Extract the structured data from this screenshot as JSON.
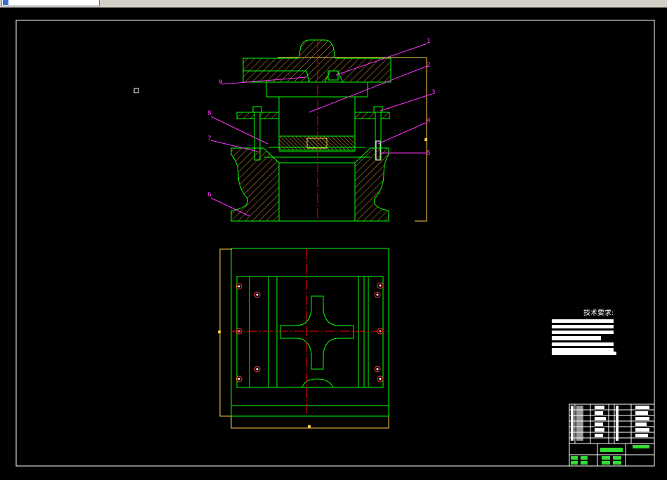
{
  "app": {
    "tab_title": ""
  },
  "colors": {
    "background": "#000000",
    "outline": "#00ff00",
    "center_line": "#ff0000",
    "leader": "#ff33ff",
    "frame": "#ffffff",
    "dimension": "#ffcc44"
  },
  "part_labels": [
    "1",
    "2",
    "3",
    "4",
    "5",
    "6",
    "7",
    "8",
    "9"
  ],
  "tech_requirements": {
    "title": "技术要求:"
  }
}
